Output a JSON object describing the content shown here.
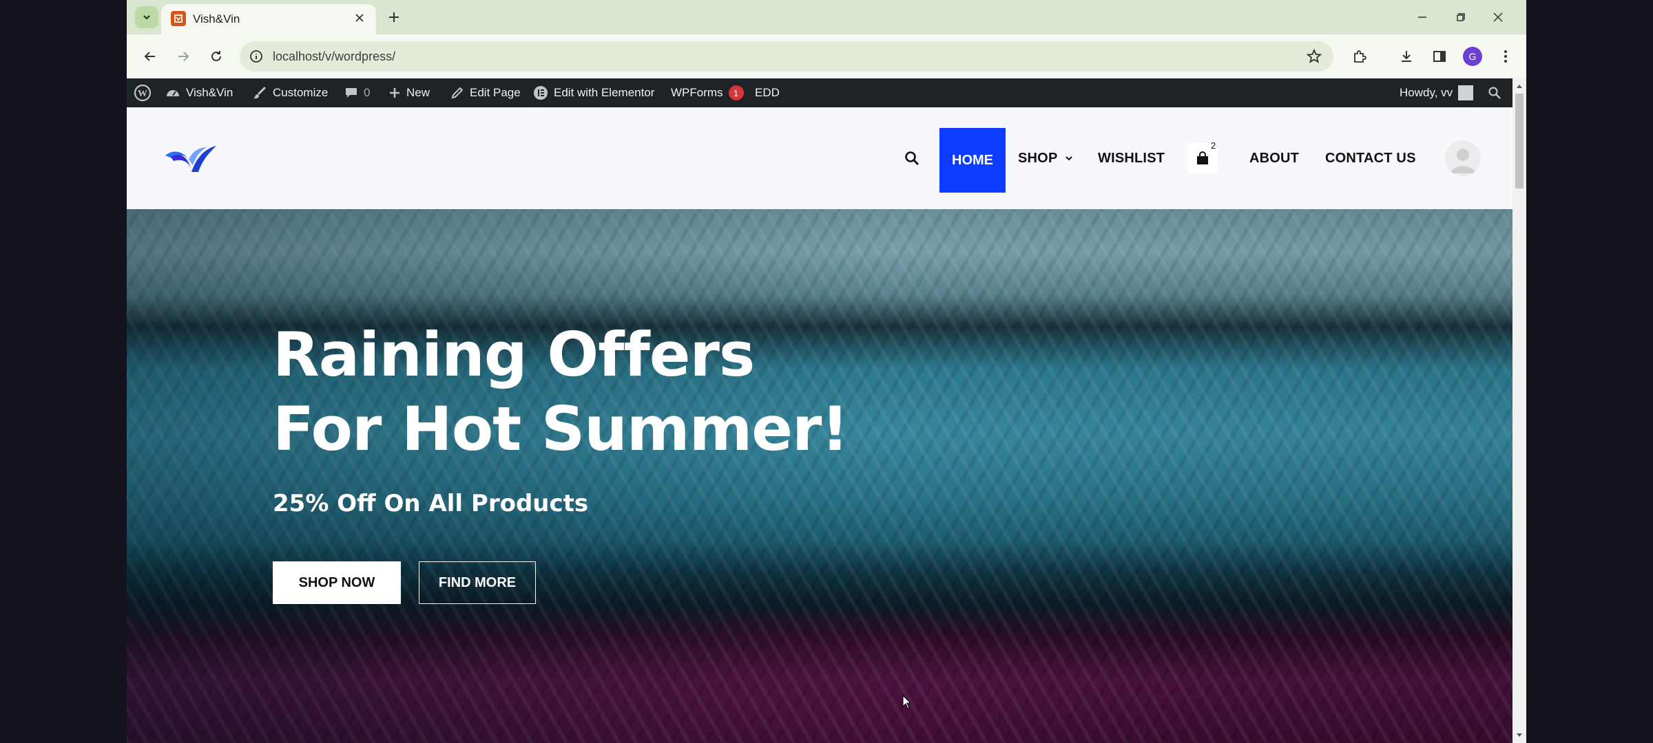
{
  "browser": {
    "tab_title": "Vish&Vin",
    "url": "localhost/v/wordpress/",
    "profile_initial": "G"
  },
  "adminbar": {
    "site_name": "Vish&Vin",
    "customize": "Customize",
    "comments_count": "0",
    "new": "New",
    "edit_page": "Edit Page",
    "edit_elementor": "Edit with Elementor",
    "wpforms": "WPForms",
    "wpforms_badge": "1",
    "edd": "EDD",
    "howdy": "Howdy, vv"
  },
  "nav": {
    "home": "HOME",
    "shop": "SHOP",
    "wishlist": "WISHLIST",
    "cart_count": "2",
    "about": "ABOUT",
    "contact": "CONTACT US"
  },
  "hero": {
    "title_line1": "Raining Offers",
    "title_line2": "For Hot Summer!",
    "subtitle": "25% Off On All Products",
    "shop_now": "SHOP NOW",
    "find_more": "FIND MORE"
  },
  "colors": {
    "nav_active": "#0c3cff",
    "adminbar": "#1d2327",
    "tabstrip": "#d8e6cf"
  }
}
